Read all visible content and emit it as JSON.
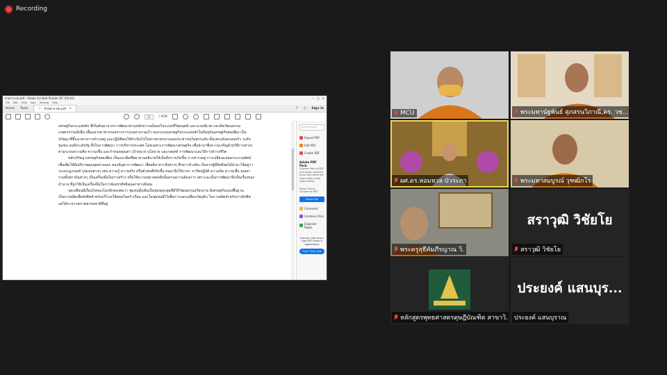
{
  "recording": {
    "label": "Recording"
  },
  "pdf": {
    "window_title": "ตัวอย่าง-บท.pdf - Adobe Acrobat Reader DC (64-bit)",
    "menu": [
      "File",
      "Edit",
      "View",
      "Sign",
      "Window",
      "Help"
    ],
    "tabs": {
      "home": "Home",
      "tools": "Tools",
      "doc": "ตัวอย่าง-บท.pdf"
    },
    "sign_in": "Sign In",
    "page_current": "21",
    "page_total": "/ 416",
    "body": [
      "เศรษฐกิจกระแสหลัก ที่เริ่มต้นมาจากการพัฒนาตามหลักความมั่นคงในระบบชีวิตมนุษย์ และระบบนิเวศ แนวคิดวัฒนธรรม เกษตรกรรมยั่งยืน เพื่อแสวงหาทางรอดจากการรุกอย่างรวดเร็ว ของระบบเศรษฐกิจกระแสหลักในปัจจุบันเศรษฐกิจพอเพียง เป็นปรัชญาที่ชี้แนวทางการดำรงอยู่ และปฏิบัติตนให้ดำเนินไปในทางสายกลางของประชาชนในทุกระดับ ตั้งแต่ระดับครอบครัว ระดับชุมชน จนถึงระดับรัฐ ทั้งในการพัฒนา การบริหารประเทศ โดยเฉพาะการพัฒนาเศรษฐกิจ เพื่อนำมาซึ่งความเจริญด้วยวิธีการต่างๆ ตามระบบความคิด ความเชื่อ และกำหนดคุณค่า เป้าหมาย นโยบาย และกลยุทธ์ การพัฒนาและวิถีการดำรงชีวิต",
      "หลักปรัชญาเศรษฐกิจพอเพียง เป็นแนวคิดที่พยายามอธิบายให้เห็นถึงการเกิดขึ้น การดำรงอยู่ การเปลี่ยนแปลงกระบวนทัศน์ เพื่อเพิ่มให้มีเสรีภาพคุณสุดทางออก ของปัญหาการพัฒนา เพื่ออธิบายว่าสิ่งต่างๆ ที่กล่าวข้างต้น เริ่มจากผู้มีอิทธิพลได้นำมาใช้อยู่ว่าระบบกฎเกณฑ์ รูปแบบต่างๆ เช่น ความรู้ ความจริง หรือตัวตนที่เกิดขึ้น ต่อมาจึงใช้ภาษา จารีตปฏิบัติ ความคิด ความเชื่อ คุณค่า รวมทั้งสถาบันต่างๆ เป็นเครื่องมือในการสร้าง หรือให้ความหมายต่อสิ่งนั้นตามความต้องการ เพราะฉะนั้นการพัฒนาจึงเป็นเรื่องของอำนาจ ที่ถูกใช้เป็นเครื่องมือในการจัดสรรสิทธิคุณค่าทางสังคม",
      "จุดเปลี่ยนมีเงื่อนไขของโลกอีกสองพบว่า ชุมชนตั้งเดิมเป็นชุมชนกลุ่มที่มีวิถีวัฒนธรรมเรียบง่าย มีเศรษฐกิจแบบพื้นฐาน เป็นการผลิตเพื่อยังชีพสำหรับบริโภคใช้สอยในครัวเรือน และในชุมชนมีไว้เพื่อการแลกเปลี่ยนวัตถุดิบ ในการผลิตสำหรับการยังชีพ แต่ได้มาจากสภาพธรรมชาติที่อยู่"
    ],
    "side": {
      "search_placeholder": "Search tools",
      "tools": [
        "Export PDF",
        "Edit PDF",
        "Create PDF"
      ],
      "tools_bottom": [
        "Comment",
        "Combine Files",
        "Organize Pages"
      ],
      "pack_title": "Adobe PDF Pack",
      "pack_desc": "Convert files to PDF and easily combine them with other file types with a paid subscription.",
      "select_label": "Select File to Convert to PDF",
      "select_button": "Select File",
      "promo": "Convert, edit and e-sign PDF forms & agreements",
      "trial_button": "Free 7-Day Trial"
    },
    "colors": {
      "accent": "#1473e6",
      "export": "#e34850",
      "edit": "#e68619",
      "create": "#e34850"
    }
  },
  "participants": [
    {
      "name": "MCU",
      "muted": true
    },
    {
      "name": "พระมหานัฐพันธ์ สุภสรนวิภาณี,ดร. วช...",
      "muted": true
    },
    {
      "name": "ผศ.ดร.หอมหวล บัวระภา",
      "muted": true,
      "speaking": true
    },
    {
      "name": "พระมหาสมบูรณ์ วุฑฒิกโร",
      "muted": true
    },
    {
      "name": "พระครูสุธีคัมภีรญาณ วิ.",
      "muted": true
    },
    {
      "name": "สราวุฒิ วิชัยโย",
      "muted": true,
      "display": "สราวุฒิ วิชัยโย"
    },
    {
      "name": "หลักสูตรพุทธศาสตรดุษฎีบัณฑิต สาขาวิ...",
      "muted": true
    },
    {
      "name": "ประยงค์ แสนบุราณ",
      "muted": false,
      "display": "ประยงค์ แสนบุร..."
    }
  ],
  "colors": {
    "background": "#1a1a1a",
    "muted_icon": "#e8473c",
    "active_speaker": "#f2d94e"
  }
}
